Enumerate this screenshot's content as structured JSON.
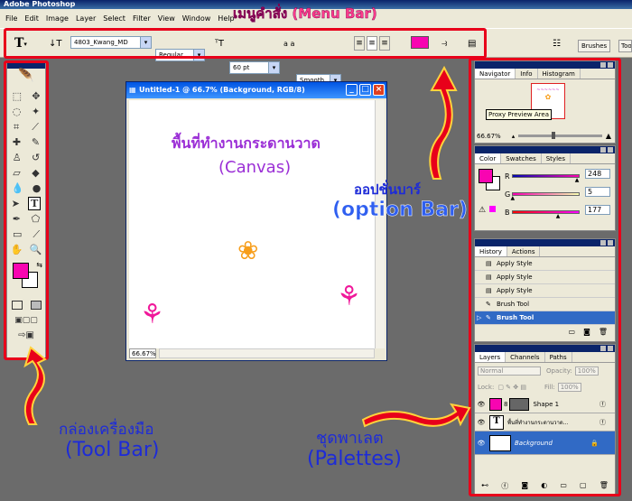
{
  "app": {
    "title": "Adobe Photoshop"
  },
  "menu": [
    "File",
    "Edit",
    "Image",
    "Layer",
    "Select",
    "Filter",
    "View",
    "Window",
    "Help"
  ],
  "options": {
    "font_family": "4803_Kwang_MD",
    "font_style": "Regular",
    "font_size": "60 pt",
    "aa_label": "a a",
    "antialias": "Smooth",
    "brushes_tab": "Brushes",
    "tool_tab": "Too"
  },
  "annotations": {
    "menu_bar": "เมนูคำสั่ง (Menu Bar)",
    "canvas_line1": "พื้นที่ทำงานกระดานวาด",
    "canvas_line2": "(Canvas)",
    "option_line1": "ออปชั่นบาร์",
    "option_line2": "(option Bar)",
    "toolbar_line1": "กล่องเครื่องมือ",
    "toolbar_line2": "(Tool Bar)",
    "palettes_line1": "ชุดพาเลต",
    "palettes_line2": "(Palettes)"
  },
  "document": {
    "title": "Untitled-1 @ 66.7% (Background, RGB/8)",
    "zoom": "66.67%"
  },
  "navigator": {
    "tabs": [
      "Navigator",
      "Info",
      "Histogram"
    ],
    "tooltip": "Proxy Preview Area",
    "zoom": "66.67%"
  },
  "color": {
    "tabs": [
      "Color",
      "Swatches",
      "Styles"
    ],
    "r_label": "R",
    "g_label": "G",
    "b_label": "B",
    "r": "248",
    "g": "5",
    "b": "177",
    "fg_color": "#f805b1",
    "r_pct": 0.97,
    "g_pct": 0.02,
    "b_pct": 0.69
  },
  "history": {
    "tabs": [
      "History",
      "Actions"
    ],
    "items": [
      "Apply Style",
      "Apply Style",
      "Apply Style",
      "Brush Tool",
      "Brush Tool"
    ]
  },
  "layers": {
    "tabs": [
      "Layers",
      "Channels",
      "Paths"
    ],
    "blend": "Normal",
    "opacity_label": "Opacity:",
    "opacity": "100%",
    "lock_label": "Lock:",
    "fill_label": "Fill:",
    "fill": "100%",
    "items": [
      "Shape 1",
      "พื้นที่ทำงานกระดานวาด...",
      "Background"
    ]
  },
  "colors": {
    "annot_red": "#e8001a",
    "annot_purple": "#9b2fd6",
    "annot_blue": "#1d2bd8"
  }
}
